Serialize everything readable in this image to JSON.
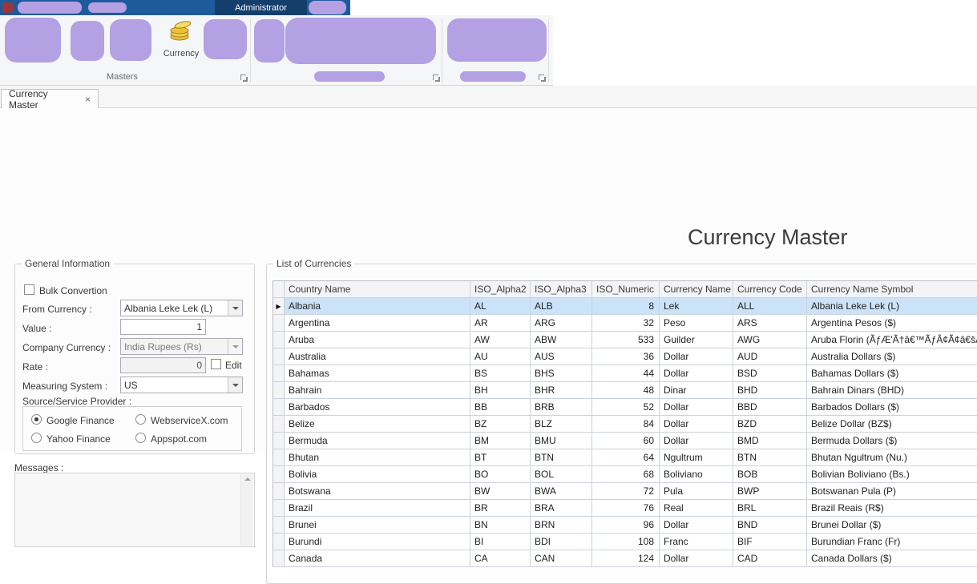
{
  "titlebar": {
    "admin_tab": "Administrator"
  },
  "ribbon": {
    "currency_label": "Currency",
    "masters_caption": "Masters"
  },
  "tab": {
    "label": "Currency Master",
    "close": "×"
  },
  "page": {
    "title": "Currency Master"
  },
  "general": {
    "group_label": "General Information",
    "bulk_convertion": "Bulk Convertion",
    "from_currency_label": "From Currency :",
    "from_currency_value": "Albania Leke Lek (L)",
    "value_label": "Value :",
    "value_value": "1",
    "company_currency_label": "Company Currency :",
    "company_currency_value": "India Rupees (Rs)",
    "rate_label": "Rate :",
    "rate_value": "0",
    "edit_label": "Edit",
    "measuring_label": "Measuring System :",
    "measuring_value": "US",
    "source_label": "Source/Service Provider :",
    "providers": [
      "Google Finance",
      "WebserviceX.com",
      "Yahoo Finance",
      "Appspot.com"
    ],
    "selected_provider": "Google Finance"
  },
  "messages": {
    "label": "Messages :"
  },
  "grid": {
    "group_label": "List of Currencies",
    "columns": [
      "Country Name",
      "ISO_Alpha2",
      "ISO_Alpha3",
      "ISO_Numeric",
      "Currency Name",
      "Currency Code",
      "Currency Name Symbol"
    ],
    "selected_row_index": 0,
    "rows": [
      [
        "Albania",
        "AL",
        "ALB",
        "8",
        "Lek",
        "ALL",
        "Albania Leke Lek (L)"
      ],
      [
        "Argentina",
        "AR",
        "ARG",
        "32",
        "Peso",
        "ARS",
        "Argentina Pesos ($)"
      ],
      [
        "Aruba",
        "AW",
        "ABW",
        "533",
        "Guilder",
        "AWG",
        "Aruba Florin (ÃƒÆ'Ã†â€™ÃƒÂ¢Ã¢â€šÂ¬Ã…Â¡ÃƒÆ'Ã‚Â¢Ã¢â€šÂ¬"
      ],
      [
        "Australia",
        "AU",
        "AUS",
        "36",
        "Dollar",
        "AUD",
        "Australia Dollars ($)"
      ],
      [
        "Bahamas",
        "BS",
        "BHS",
        "44",
        "Dollar",
        "BSD",
        "Bahamas Dollars ($)"
      ],
      [
        "Bahrain",
        "BH",
        "BHR",
        "48",
        "Dinar",
        "BHD",
        "Bahrain Dinars (BHD)"
      ],
      [
        "Barbados",
        "BB",
        "BRB",
        "52",
        "Dollar",
        "BBD",
        "Barbados Dollars  ($)"
      ],
      [
        "Belize",
        "BZ",
        "BLZ",
        "84",
        "Dollar",
        "BZD",
        "Belize Dollar (BZ$)"
      ],
      [
        "Bermuda",
        "BM",
        "BMU",
        "60",
        "Dollar",
        "BMD",
        "Bermuda Dollars ($)"
      ],
      [
        "Bhutan",
        "BT",
        "BTN",
        "64",
        "Ngultrum",
        "BTN",
        "Bhutan Ngultrum (Nu.)"
      ],
      [
        "Bolivia",
        "BO",
        "BOL",
        "68",
        "Boliviano",
        "BOB",
        "Bolivian Boliviano (Bs.)"
      ],
      [
        "Botswana",
        "BW",
        "BWA",
        "72",
        "Pula",
        "BWP",
        "Botswanan Pula (P)"
      ],
      [
        "Brazil",
        "BR",
        "BRA",
        "76",
        "Real",
        "BRL",
        "Brazil Reais (R$)"
      ],
      [
        "Brunei",
        "BN",
        "BRN",
        "96",
        "Dollar",
        "BND",
        "Brunei Dollar  ($)"
      ],
      [
        "Burundi",
        "BI",
        "BDI",
        "108",
        "Franc",
        "BIF",
        "Burundian Franc (Fr)"
      ],
      [
        "Canada",
        "CA",
        "CAN",
        "124",
        "Dollar",
        "CAD",
        "Canada Dollars  ($)"
      ]
    ]
  }
}
